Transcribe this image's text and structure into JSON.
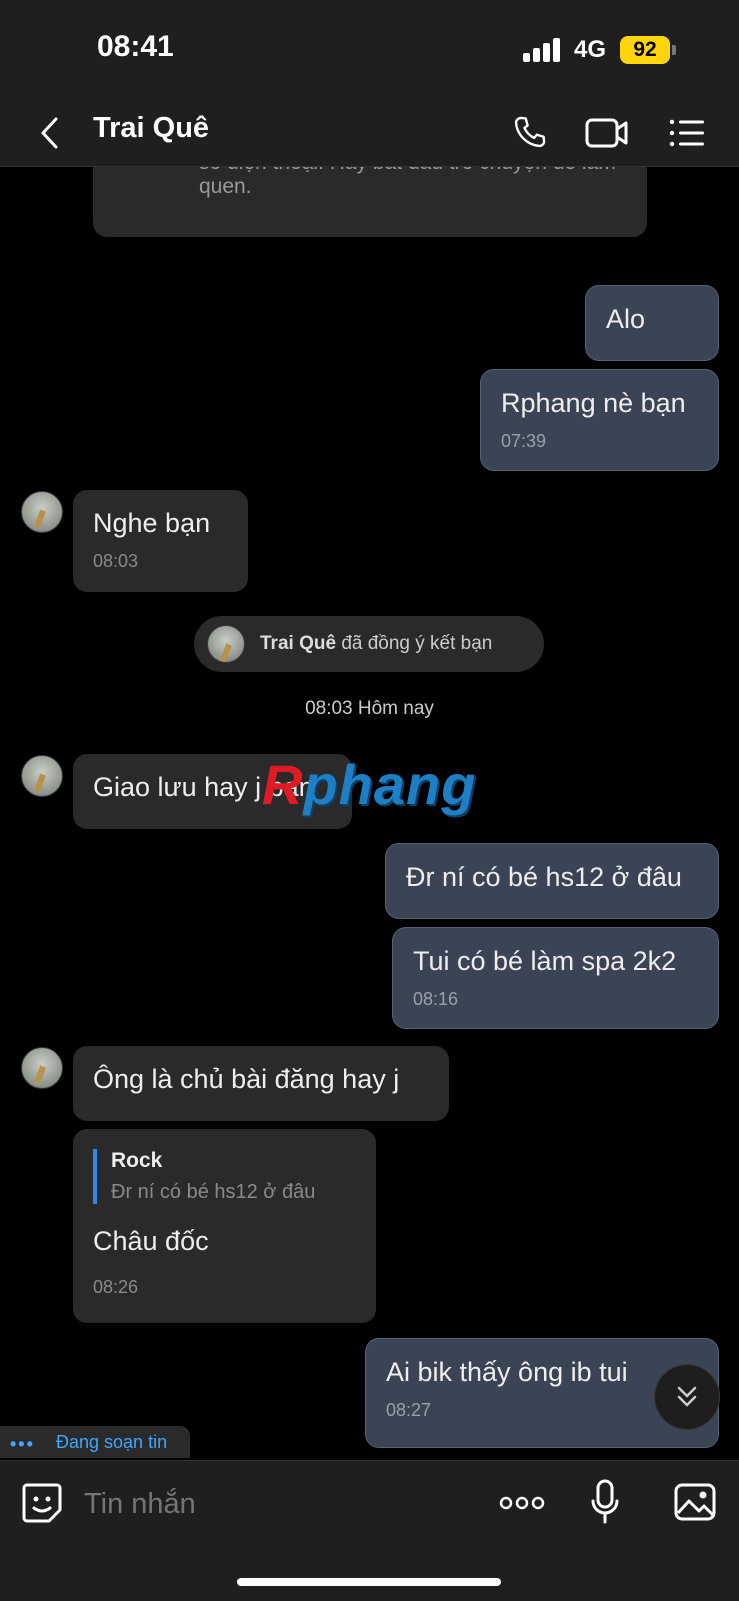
{
  "status_bar": {
    "time": "08:41",
    "network": "4G",
    "battery": "92"
  },
  "header": {
    "title": "Trai Quê",
    "icons": {
      "back": "chevron-left-icon",
      "call": "phone-icon",
      "video": "video-camera-icon",
      "menu": "list-menu-icon"
    }
  },
  "system_card": {
    "text": "Bạn vừa gửi yêu cầu kết bạn đến Trai Quê từ số điện thoại. Hãy bắt đầu trò chuyện để làm quen."
  },
  "messages": [
    {
      "side": "me",
      "text": "Alo"
    },
    {
      "side": "me",
      "text": "Rphang nè bạn",
      "time": "07:39"
    },
    {
      "side": "them",
      "text": "Nghe bạn",
      "time": "08:03"
    },
    {
      "side": "them",
      "text": "Giao lưu hay j bạn"
    },
    {
      "side": "me",
      "text": "Đr ní có bé hs12 ở đâu"
    },
    {
      "side": "me",
      "text": "Tui có bé làm spa 2k2",
      "time": "08:16"
    },
    {
      "side": "them",
      "text": "Ông là chủ bài đăng hay j"
    },
    {
      "side": "them",
      "quote": {
        "name": "Rock",
        "text": "Đr ní có bé hs12 ở đâu"
      },
      "text": "Châu đốc",
      "time": "08:26"
    },
    {
      "side": "me",
      "text": "Ai bik thấy ông ib tui",
      "time": "08:27"
    }
  ],
  "system_pill": {
    "name": "Trai Quê",
    "text": "đã đồng ý kết bạn"
  },
  "date_separator": "08:03 Hôm nay",
  "watermark": {
    "first": "R",
    "rest": "phang"
  },
  "typing": {
    "label": "Đang soạn tin"
  },
  "composer": {
    "placeholder": "Tin nhắn"
  },
  "colors": {
    "my_bubble": "#3a4455",
    "their_bubble": "#2a2a2a",
    "accent": "#2d88e6",
    "battery": "#ffd60a"
  }
}
